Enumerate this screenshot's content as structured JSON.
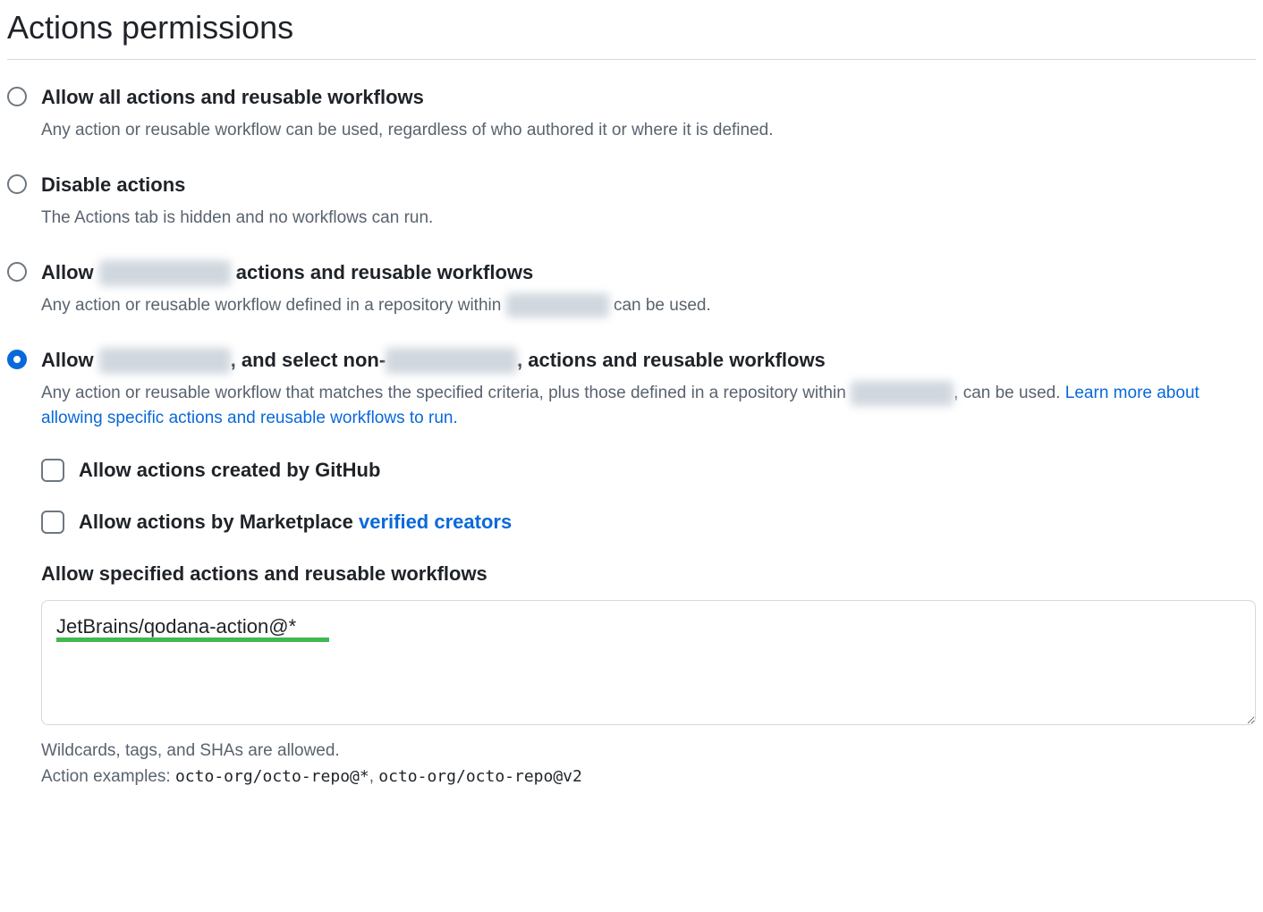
{
  "title": "Actions permissions",
  "options": {
    "allow_all": {
      "label": "Allow all actions and reusable workflows",
      "desc": "Any action or reusable workflow can be used, regardless of who authored it or where it is defined."
    },
    "disable": {
      "label": "Disable actions",
      "desc": "The Actions tab is hidden and no workflows can run."
    },
    "allow_org": {
      "label_prefix": "Allow ",
      "label_suffix": " actions and reusable workflows",
      "desc_prefix": "Any action or reusable workflow defined in a repository within ",
      "desc_suffix": " can be used."
    },
    "allow_select": {
      "label_prefix": "Allow ",
      "label_mid": ", and select non-",
      "label_suffix": ", actions and reusable workflows",
      "desc_prefix": "Any action or reusable workflow that matches the specified criteria, plus those defined in a repository within ",
      "desc_mid": ", can be used. ",
      "learn_link": "Learn more about allowing specific actions and reusable workflows to run."
    }
  },
  "sub": {
    "github_actions": "Allow actions created by GitHub",
    "marketplace_prefix": "Allow actions by Marketplace ",
    "verified_link": "verified creators",
    "specified_label": "Allow specified actions and reusable workflows",
    "textarea_value": "JetBrains/qodana-action@*"
  },
  "hints": {
    "line1": "Wildcards, tags, and SHAs are allowed.",
    "line2_prefix": "Action examples: ",
    "example1": "octo-org/octo-repo@*",
    "separator": ", ",
    "example2": "octo-org/octo-repo@v2"
  },
  "redacted_placeholder": "xxxxx xx xxxx"
}
